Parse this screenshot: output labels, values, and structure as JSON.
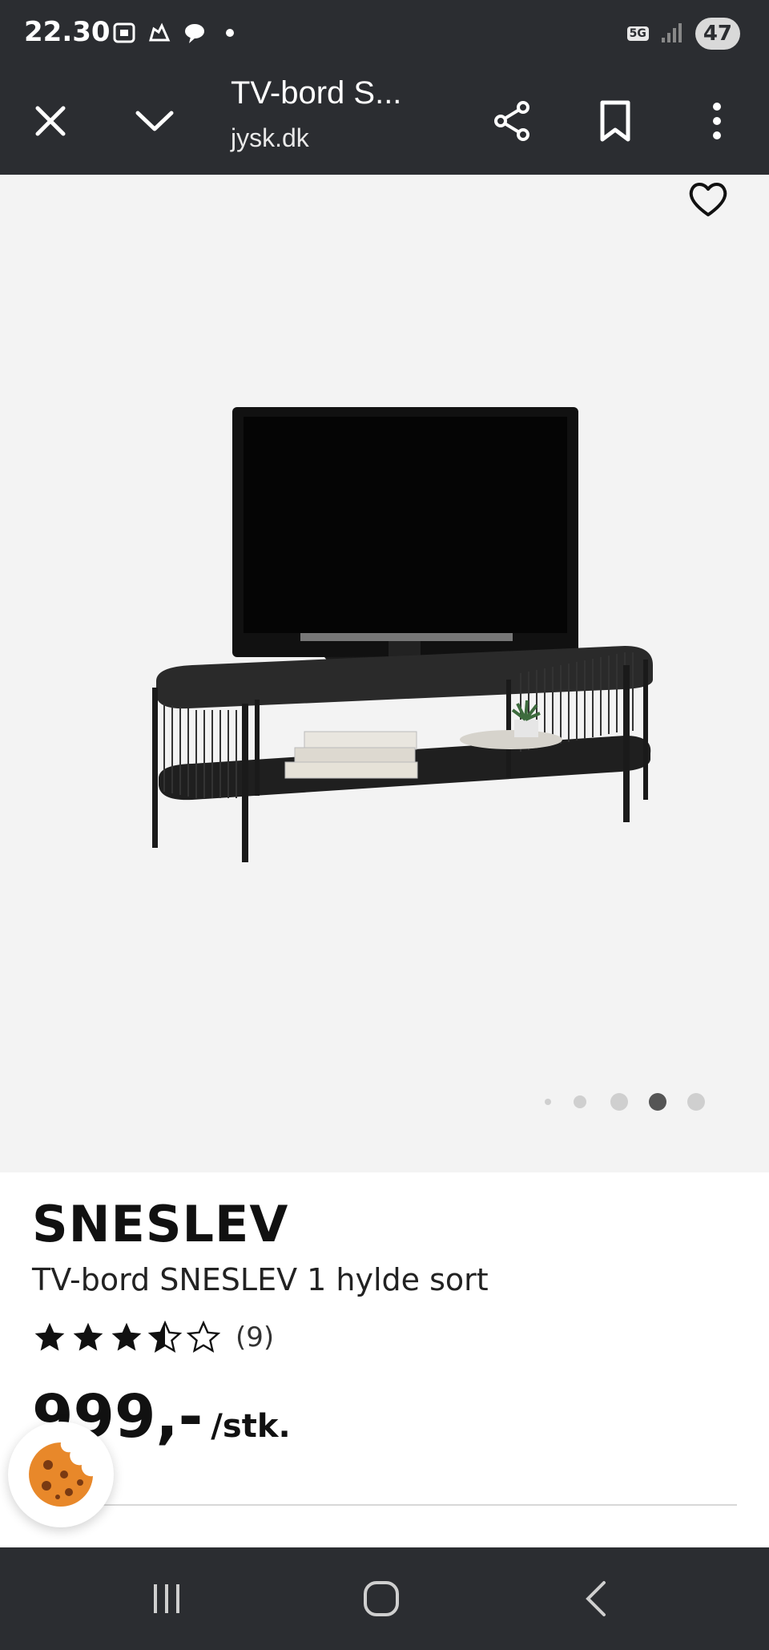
{
  "status_bar": {
    "time": "22.30",
    "network": "5G",
    "battery": "47"
  },
  "toolbar": {
    "title": "TV-bord S...",
    "domain": "jysk.dk",
    "icons": [
      "close-icon",
      "chevron-down-icon",
      "share-icon",
      "bookmark-icon",
      "more-vert-icon"
    ]
  },
  "gallery": {
    "total_images": 5,
    "active_index": 3
  },
  "product": {
    "brand": "SNESLEV",
    "name": "TV-bord SNESLEV 1 hylde sort",
    "rating": 3.5,
    "rating_max": 5,
    "review_count": "(9)",
    "price": "999,-",
    "unit": "/stk."
  },
  "colors": {
    "chrome": "#2b2d31",
    "image_bg": "#f3f3f3",
    "cookie": "#e8882a"
  }
}
